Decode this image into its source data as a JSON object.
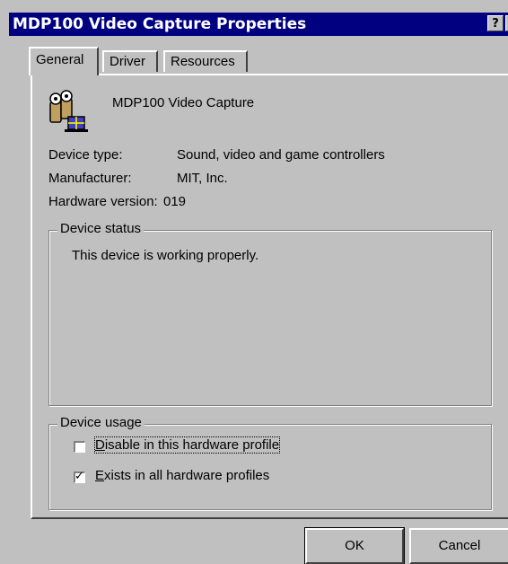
{
  "window": {
    "title": "MDP100 Video Capture Properties",
    "help_glyph": "?",
    "close_glyph": "✕"
  },
  "tabs": [
    {
      "label": "General",
      "active": true
    },
    {
      "label": "Driver",
      "active": false
    },
    {
      "label": "Resources",
      "active": false
    }
  ],
  "device": {
    "icon": "video-capture-device-icon",
    "name": "MDP100 Video Capture"
  },
  "properties": [
    {
      "label": "Device type:",
      "value": "Sound, video and game controllers"
    },
    {
      "label": "Manufacturer:",
      "value": "MIT, Inc."
    },
    {
      "label": "Hardware version:",
      "value": "019"
    }
  ],
  "device_status": {
    "title": "Device status",
    "text": "This device is working properly."
  },
  "device_usage": {
    "title": "Device usage",
    "disable": {
      "mnemonic": "D",
      "rest": "isable in this hardware profile",
      "checked": false
    },
    "exists": {
      "mnemonic": "E",
      "rest": "xists in all hardware profiles",
      "checked": true
    }
  },
  "buttons": {
    "ok": "OK",
    "cancel": "Cancel"
  },
  "colors": {
    "titlebar": "#000080",
    "face": "#c0c0c0"
  }
}
